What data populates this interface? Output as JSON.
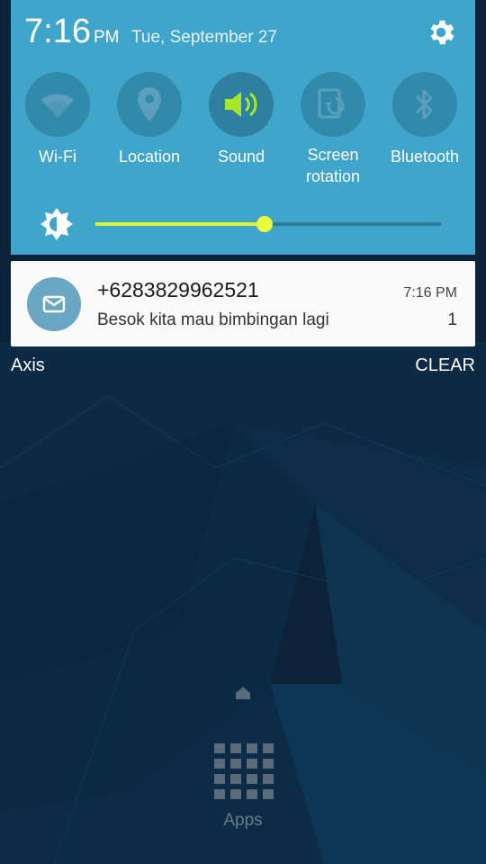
{
  "status": {
    "time": "7:16",
    "ampm": "PM",
    "date": "Tue, September 27"
  },
  "quick_settings": [
    {
      "label": "Wi-Fi",
      "icon": "wifi-icon",
      "active": false
    },
    {
      "label": "Location",
      "icon": "location-pin-icon",
      "active": false
    },
    {
      "label": "Sound",
      "icon": "speaker-icon",
      "active": true
    },
    {
      "label": "Screen\nrotation",
      "icon": "screen-rotation-icon",
      "active": false
    },
    {
      "label": "Bluetooth",
      "icon": "bluetooth-icon",
      "active": false
    }
  ],
  "brightness": {
    "level": 0.49
  },
  "notification": {
    "icon": "message-icon",
    "title": "+6283829962521",
    "body": "Besok kita mau bimbingan lagi",
    "time": "7:16 PM",
    "count": "1"
  },
  "carrier": "Axis",
  "clear_label": "CLEAR",
  "apps_label": "Apps",
  "colors": {
    "panel": "#3fa5cb",
    "tile": "#328aab",
    "accent": "#d8f53a",
    "wallpaper": "#0a2238"
  }
}
